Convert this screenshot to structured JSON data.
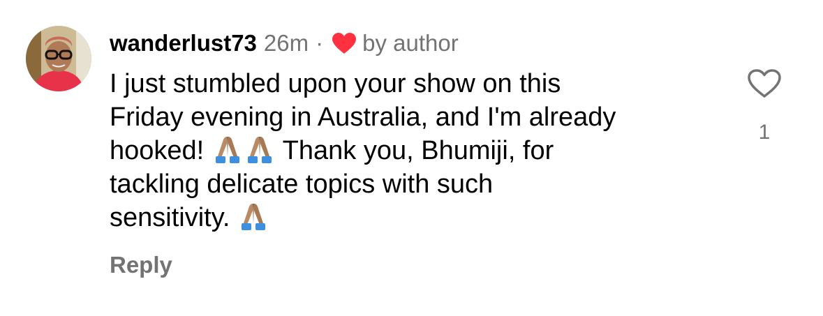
{
  "comment": {
    "username": "wanderlust73",
    "timestamp": "26m",
    "separator": "·",
    "author_badge": {
      "icon": "heart-icon",
      "color": "#ff3040",
      "label": "by author"
    },
    "text_lines": {
      "l1": "I just stumbled upon your show on this",
      "l2": "Friday evening in Australia, and I'm already",
      "l3a": "hooked!",
      "l3b": "Thank you, Bhumiji, for",
      "l4": "tackling delicate topics with such",
      "l5": "sensitivity."
    },
    "emoji": "folded-hands-medium-skin-tone",
    "reply_label": "Reply",
    "like": {
      "icon": "heart-outline-icon",
      "count": "1"
    }
  },
  "colors": {
    "primary_text": "#000000",
    "secondary_text": "#737373",
    "accent_heart": "#ff3040"
  }
}
